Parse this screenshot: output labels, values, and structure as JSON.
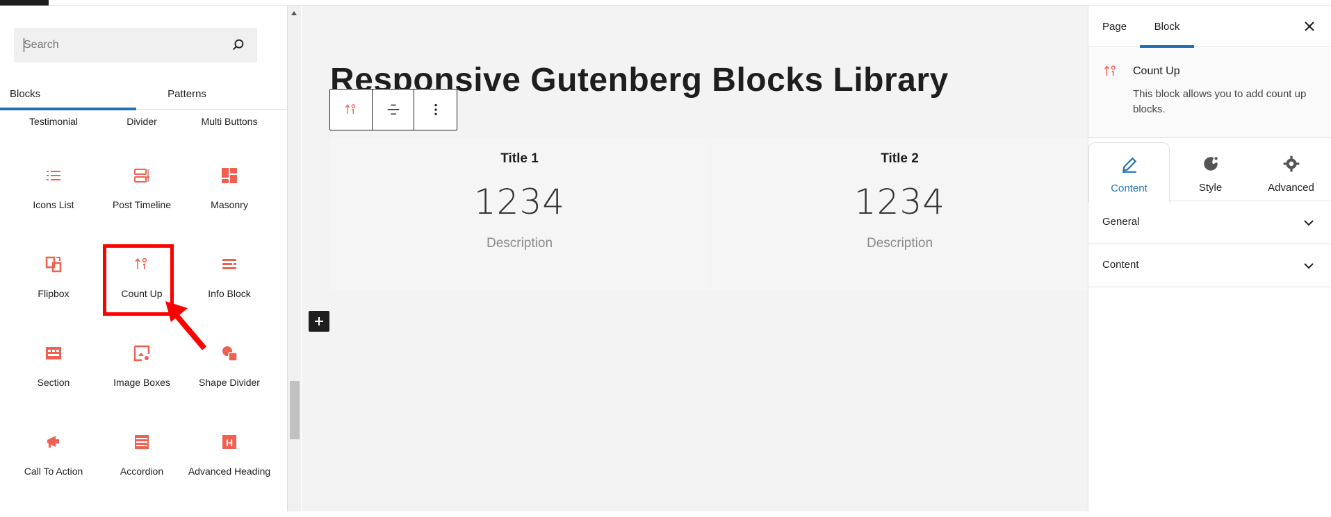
{
  "inserter": {
    "search_placeholder": "Search",
    "tabs": [
      "Blocks",
      "Patterns"
    ],
    "blocks": [
      {
        "label": "Testimonial",
        "icon": "testimonial-icon"
      },
      {
        "label": "Divider",
        "icon": "divider-icon"
      },
      {
        "label": "Multi Buttons",
        "icon": "multi-buttons-icon"
      },
      {
        "label": "Icons List",
        "icon": "list-icon"
      },
      {
        "label": "Post Timeline",
        "icon": "timeline-icon"
      },
      {
        "label": "Masonry",
        "icon": "masonry-icon"
      },
      {
        "label": "Flipbox",
        "icon": "flipbox-icon"
      },
      {
        "label": "Count Up",
        "icon": "count-up-icon"
      },
      {
        "label": "Info Block",
        "icon": "info-block-icon"
      },
      {
        "label": "Section",
        "icon": "section-icon"
      },
      {
        "label": "Image Boxes",
        "icon": "image-boxes-icon"
      },
      {
        "label": "Shape Divider",
        "icon": "shape-divider-icon"
      },
      {
        "label": "Call To Action",
        "icon": "megaphone-icon"
      },
      {
        "label": "Accordion",
        "icon": "accordion-icon"
      },
      {
        "label": "Advanced Heading",
        "icon": "heading-icon"
      }
    ]
  },
  "canvas": {
    "page_title": "Responsive Gutenberg Blocks Library",
    "counters": [
      {
        "title": "Title 1",
        "number": "1234",
        "description": "Description"
      },
      {
        "title": "Title 2",
        "number": "1234",
        "description": "Description"
      }
    ]
  },
  "sidebar": {
    "tabs": [
      "Page",
      "Block"
    ],
    "block_card": {
      "title": "Count Up",
      "description": "This block allows you to add count up blocks."
    },
    "panel_tabs": [
      "Content",
      "Style",
      "Advanced"
    ],
    "accordions": [
      "General",
      "Content"
    ]
  },
  "colors": {
    "accent": "#2271b1",
    "icon": "#f06050",
    "highlight": "#ff0000"
  }
}
